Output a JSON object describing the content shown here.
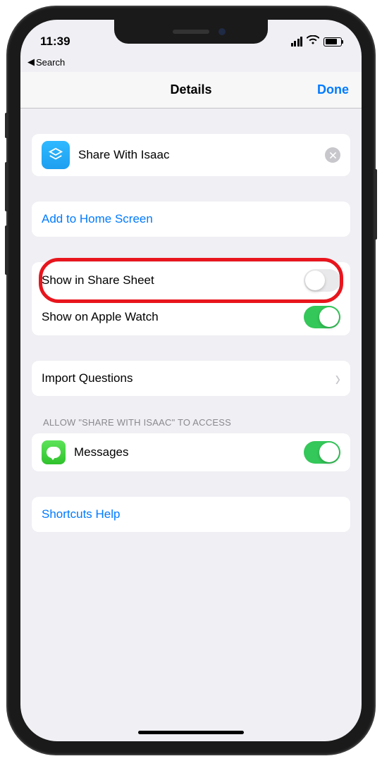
{
  "status": {
    "time": "11:39"
  },
  "breadcrumb": {
    "label": "Search"
  },
  "nav": {
    "title": "Details",
    "done": "Done"
  },
  "shortcut": {
    "name": "Share With Isaac"
  },
  "actions": {
    "add_home": "Add to Home Screen"
  },
  "toggles": {
    "share_sheet": {
      "label": "Show in Share Sheet",
      "on": false
    },
    "apple_watch": {
      "label": "Show on Apple Watch",
      "on": true
    }
  },
  "import": {
    "label": "Import Questions"
  },
  "access": {
    "header": "ALLOW \"SHARE WITH ISAAC\" TO ACCESS",
    "items": [
      {
        "label": "Messages",
        "on": true
      }
    ]
  },
  "help": {
    "label": "Shortcuts Help"
  }
}
